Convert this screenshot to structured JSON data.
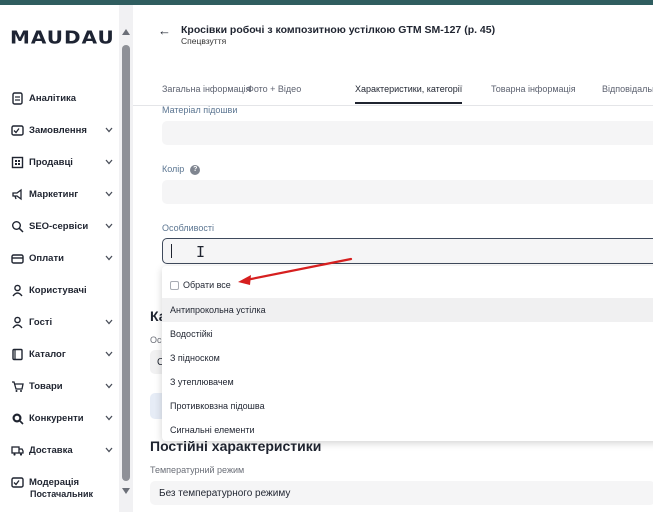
{
  "brand": {
    "logo": "MAUDAU"
  },
  "sidebar": {
    "items": [
      {
        "label": "Аналітика",
        "icon": "document-icon",
        "chevron": false
      },
      {
        "label": "Замовлення",
        "icon": "checklist-icon",
        "chevron": true
      },
      {
        "label": "Продавці",
        "icon": "building-icon",
        "chevron": true
      },
      {
        "label": "Маркетинг",
        "icon": "megaphone-icon",
        "chevron": true
      },
      {
        "label": "SEO-сервіси",
        "icon": "seo-icon",
        "chevron": true
      },
      {
        "label": "Оплати",
        "icon": "card-icon",
        "chevron": true
      },
      {
        "label": "Користувачі",
        "icon": "user-icon",
        "chevron": false
      },
      {
        "label": "Гості",
        "icon": "user-icon",
        "chevron": true
      },
      {
        "label": "Каталог",
        "icon": "catalog-icon",
        "chevron": true
      },
      {
        "label": "Товари",
        "icon": "cart-icon",
        "chevron": true
      },
      {
        "label": "Конкуренти",
        "icon": "search-icon",
        "chevron": true
      },
      {
        "label": "Доставка",
        "icon": "truck-icon",
        "chevron": true
      },
      {
        "label": "Модерація",
        "icon": "checklist-icon",
        "chevron": false
      }
    ],
    "cut_item": "Постачальник"
  },
  "header": {
    "back_icon": "arrow-left-icon",
    "title": "Кросівки робочі з композитною устілкою GTM SM-127 (р. 45)",
    "subtitle": "Спецвзуття"
  },
  "tabs": [
    {
      "label": "Загальна інформація",
      "active": false
    },
    {
      "label": "Фото + Відео",
      "active": false
    },
    {
      "label": "Характеристики, категорії",
      "active": true
    },
    {
      "label": "Товарна інформація",
      "active": false
    },
    {
      "label": "Відповідальні",
      "active": false
    }
  ],
  "form": {
    "sole_material_label": "Матеріал підошви",
    "color_label": "Колір",
    "features_label": "Особливості"
  },
  "dropdown": {
    "select_all": "Обрати все",
    "options": [
      "Антипрокольна устілка",
      "Водостійкі",
      "З підноском",
      "З утеплювачем",
      "Противковзна підошва",
      "Сигнальні елементи"
    ],
    "highlighted_index": 0
  },
  "background": {
    "heading_partial": "Ка",
    "label_partial": "Ос",
    "field_partial": "С"
  },
  "constant_section": {
    "heading": "Постійні характеристики",
    "temp_label": "Температурний режим",
    "temp_value": "Без температурного режиму"
  },
  "colors": {
    "topbar": "#2f5d5f",
    "annotation_arrow": "#d61f1f",
    "field_bg": "#f5f5f6",
    "label_blue": "#5b7591"
  }
}
